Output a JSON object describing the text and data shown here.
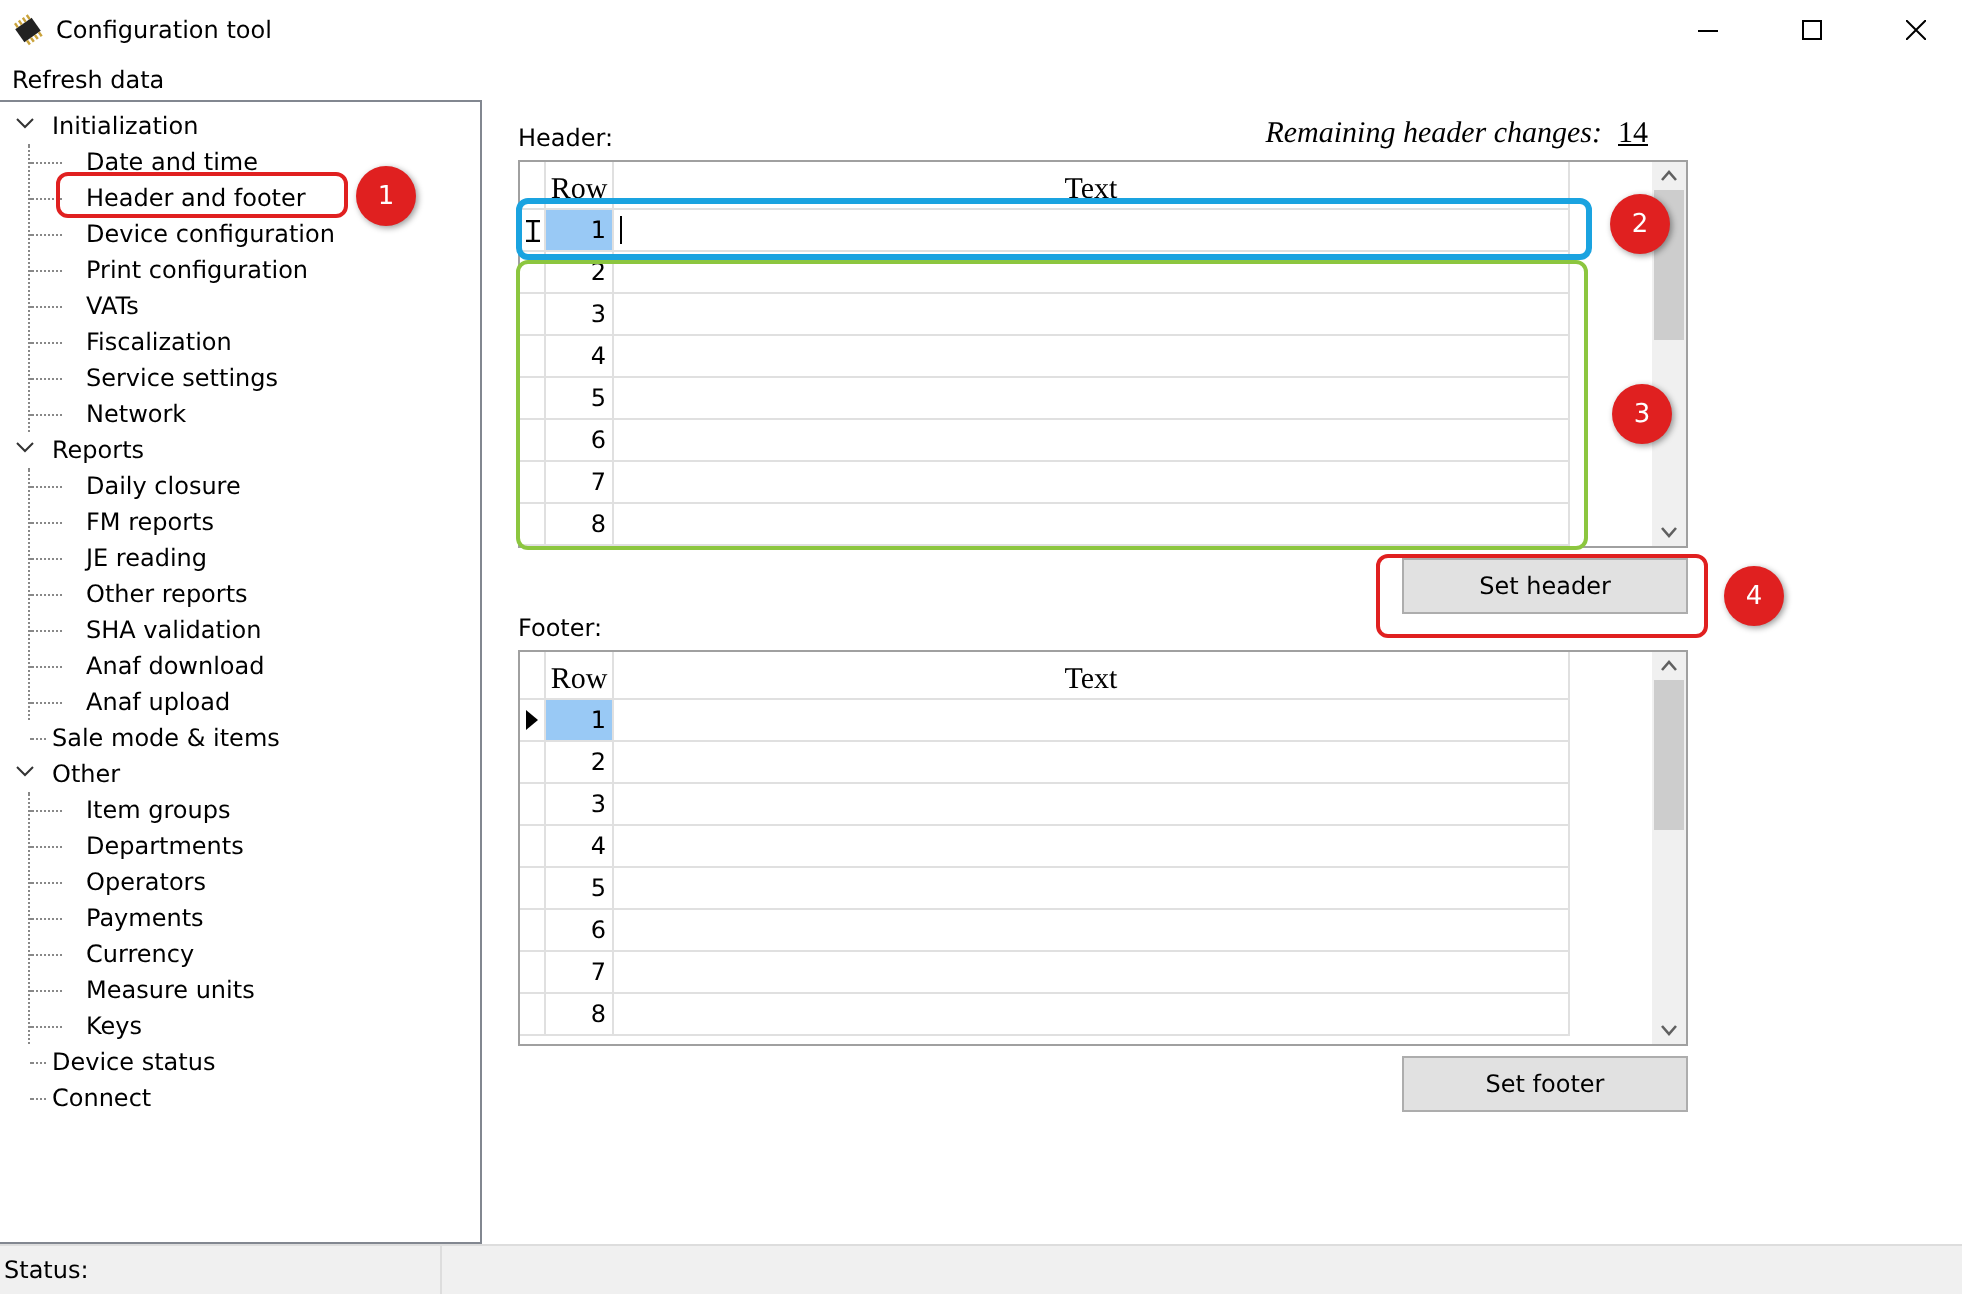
{
  "window": {
    "title": "Configuration tool"
  },
  "menu": [
    "Refresh data"
  ],
  "tree": [
    {
      "label": "Initialization",
      "expanded": true,
      "children": [
        {
          "label": "Date and time"
        },
        {
          "label": "Header and footer"
        },
        {
          "label": "Device configuration"
        },
        {
          "label": "Print configuration"
        },
        {
          "label": "VATs"
        },
        {
          "label": "Fiscalization"
        },
        {
          "label": "Service settings"
        },
        {
          "label": "Network"
        }
      ]
    },
    {
      "label": "Reports",
      "expanded": true,
      "children": [
        {
          "label": "Daily closure"
        },
        {
          "label": "FM reports"
        },
        {
          "label": "JE reading"
        },
        {
          "label": "Other reports"
        },
        {
          "label": "SHA validation"
        },
        {
          "label": "Anaf download"
        },
        {
          "label": "Anaf upload"
        }
      ]
    },
    {
      "label": "Sale mode & items"
    },
    {
      "label": "Other",
      "expanded": true,
      "children": [
        {
          "label": "Item groups"
        },
        {
          "label": "Departments"
        },
        {
          "label": "Operators"
        },
        {
          "label": "Payments"
        },
        {
          "label": "Currency"
        },
        {
          "label": "Measure units"
        },
        {
          "label": "Keys"
        }
      ]
    },
    {
      "label": "Device status"
    },
    {
      "label": "Connect"
    }
  ],
  "remaining": {
    "label": "Remaining header changes:",
    "value": "14"
  },
  "header": {
    "label": "Header:",
    "kind": "editing",
    "columns": [
      "Row",
      "Text"
    ],
    "button": "Set header",
    "rows": [
      {
        "row": "1",
        "selected": true
      },
      {
        "row": "2",
        "selected": false
      },
      {
        "row": "3",
        "selected": false
      },
      {
        "row": "4",
        "selected": false
      },
      {
        "row": "5",
        "selected": false
      },
      {
        "row": "6",
        "selected": false
      },
      {
        "row": "7",
        "selected": false
      },
      {
        "row": "8",
        "selected": false
      }
    ]
  },
  "footer": {
    "label": "Footer:",
    "kind": "current",
    "columns": [
      "Row",
      "Text"
    ],
    "button": "Set footer",
    "rows": [
      {
        "row": "1",
        "selected": true
      },
      {
        "row": "2",
        "selected": false
      },
      {
        "row": "3",
        "selected": false
      },
      {
        "row": "4",
        "selected": false
      },
      {
        "row": "5",
        "selected": false
      },
      {
        "row": "6",
        "selected": false
      },
      {
        "row": "7",
        "selected": false
      },
      {
        "row": "8",
        "selected": false
      }
    ]
  },
  "annotations": [
    {
      "label": "1",
      "color": "#e02020"
    },
    {
      "label": "2",
      "color": "#1aa3e0"
    },
    {
      "label": "3",
      "color": "#8cc63f"
    },
    {
      "label": "4",
      "color": "#e02020"
    }
  ],
  "status_bar": {
    "label": "Status:"
  }
}
